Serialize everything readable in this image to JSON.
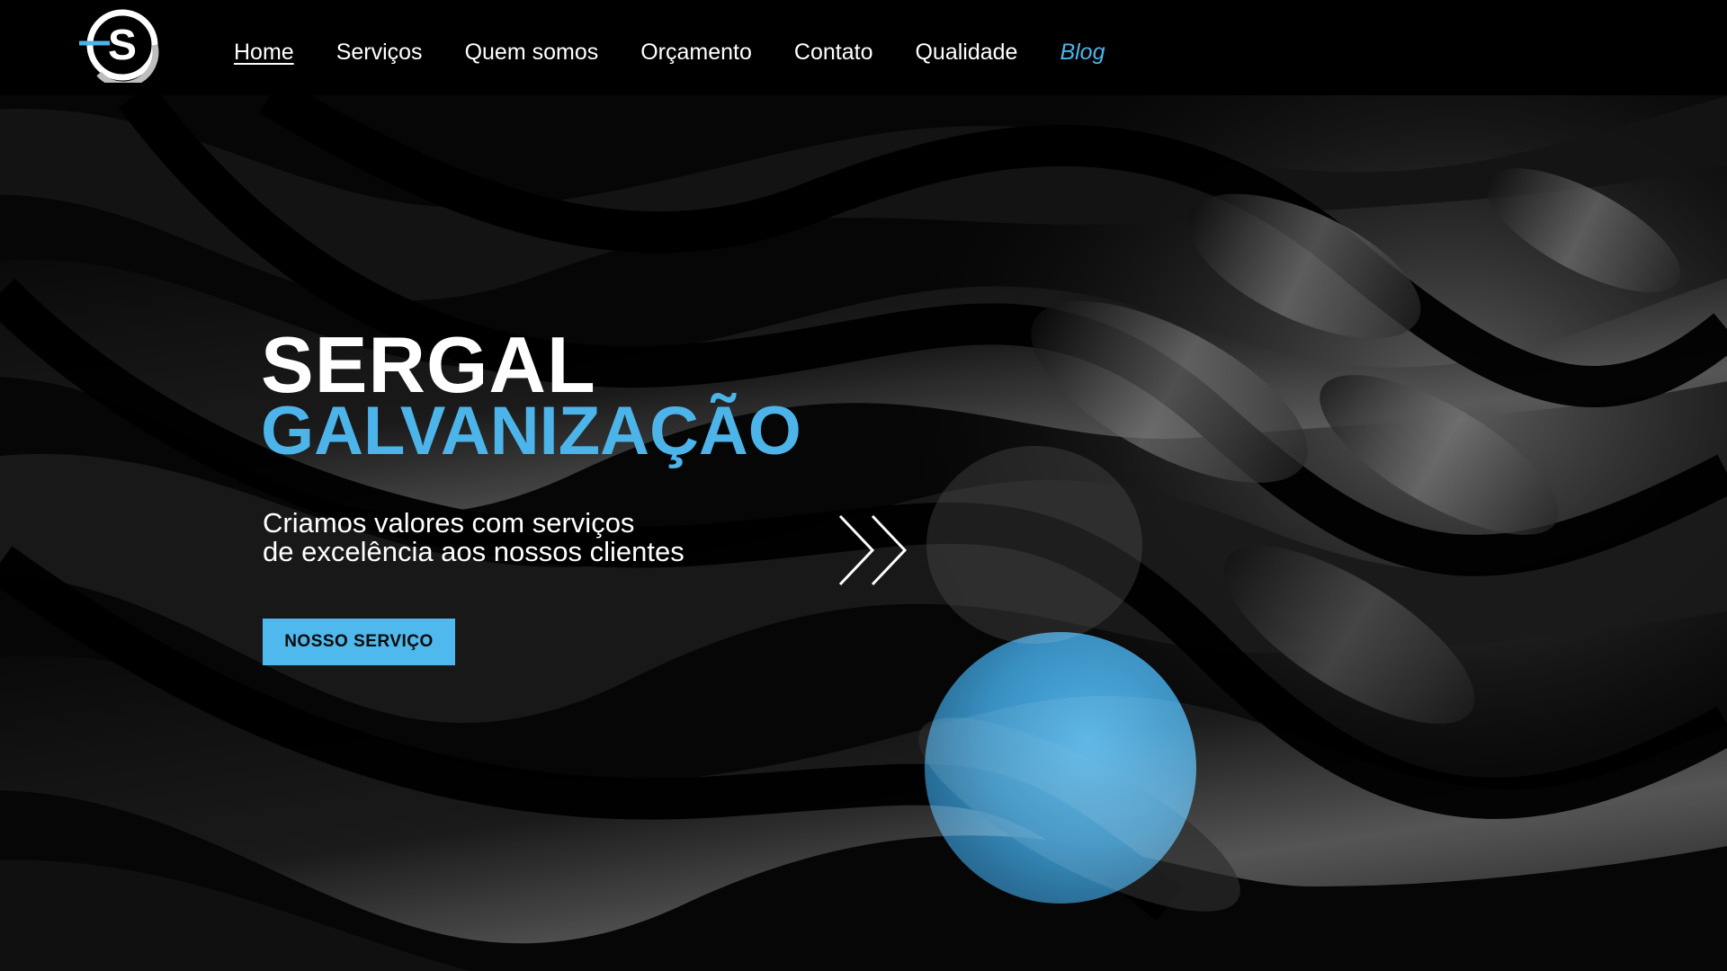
{
  "brand": {
    "logo_letter": "S",
    "accent_color": "#4db4ea"
  },
  "nav": {
    "items": [
      {
        "label": "Home",
        "active": true
      },
      {
        "label": "Serviços"
      },
      {
        "label": "Quem somos"
      },
      {
        "label": "Orçamento"
      },
      {
        "label": "Contato"
      },
      {
        "label": "Qualidade"
      },
      {
        "label": "Blog",
        "highlight": true
      }
    ]
  },
  "hero": {
    "title_line1": "SERGAL",
    "title_line2": "GALVANIZAÇÃO",
    "subtitle_line1": "Criamos valores com serviços",
    "subtitle_line2": "de excelência aos nossos clientes",
    "cta_label": "NOSSO SERVIÇO",
    "decor_icon": "double-chevron-right-icon"
  }
}
